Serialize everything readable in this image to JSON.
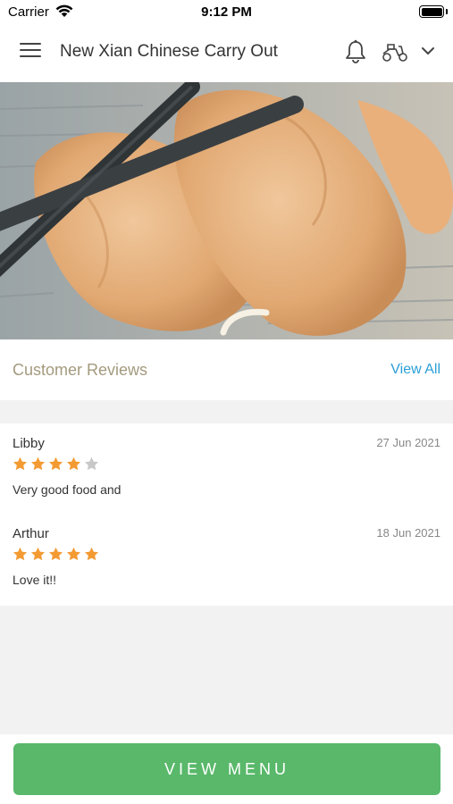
{
  "status_bar": {
    "carrier": "Carrier",
    "time": "9:12 PM"
  },
  "header": {
    "title": "New Xian Chinese Carry Out",
    "icons": [
      "menu-icon",
      "bell-icon",
      "delivery-scooter-icon",
      "chevron-down-icon"
    ]
  },
  "hero": {
    "image": "fried egg rolls with chopsticks"
  },
  "reviews_section": {
    "title": "Customer Reviews",
    "view_all": "View All"
  },
  "reviews": [
    {
      "name": "Libby",
      "date": "27 Jun 2021",
      "rating": 4,
      "max_rating": 5,
      "text": "Very good food and"
    },
    {
      "name": "Arthur",
      "date": "18 Jun 2021",
      "rating": 5,
      "max_rating": 5,
      "text": "Love it!!"
    }
  ],
  "footer": {
    "button_label": "VIEW MENU"
  },
  "colors": {
    "accent_green": "#59b86a",
    "link_blue": "#2a9fd6",
    "section_title": "#a39a7e",
    "star_filled": "#f39a32",
    "star_empty": "#c8c8c8"
  }
}
